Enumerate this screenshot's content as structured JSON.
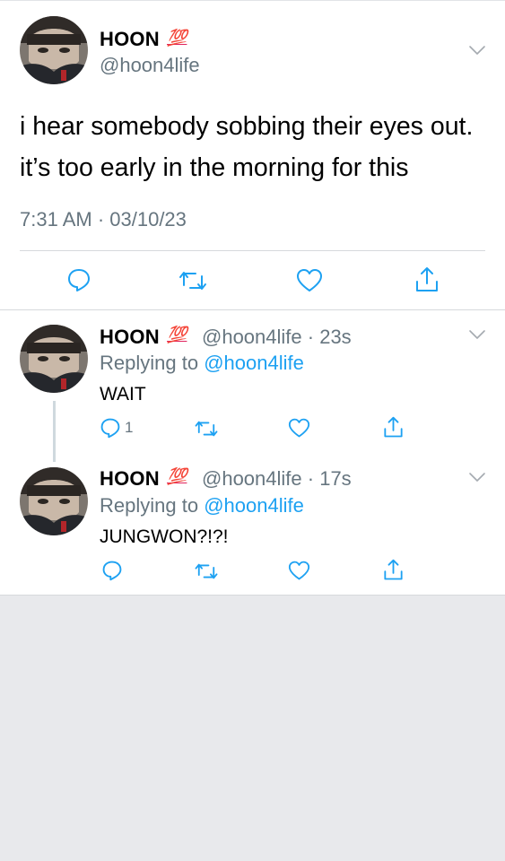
{
  "main_tweet": {
    "name": "HOON",
    "badge": "💯",
    "handle": "@hoon4life",
    "text": "i hear somebody sobbing their eyes out. it’s too early in the morning for this",
    "timestamp": "7:31 AM · 03/10/23",
    "actions": [
      "comment-icon",
      "retweet-icon",
      "heart-icon",
      "share-icon"
    ]
  },
  "replies": [
    {
      "name": "HOON",
      "badge": "💯",
      "handle": "@hoon4life",
      "time": "· 23s",
      "replying_prefix": "Replying to ",
      "replying_handle": "@hoon4life",
      "text": "WAIT",
      "reply_count": "1"
    },
    {
      "name": "HOON",
      "badge": "💯",
      "handle": "@hoon4life",
      "time": "· 17s",
      "replying_prefix": "Replying to ",
      "replying_handle": "@hoon4life",
      "text": "JUNGWON?!?!",
      "reply_count": ""
    }
  ],
  "colors": {
    "link": "#1da1f2",
    "muted": "#66757f",
    "divider": "#d6d9dc",
    "badge": "#e0245e",
    "page_bg": "#e8e9ec"
  }
}
